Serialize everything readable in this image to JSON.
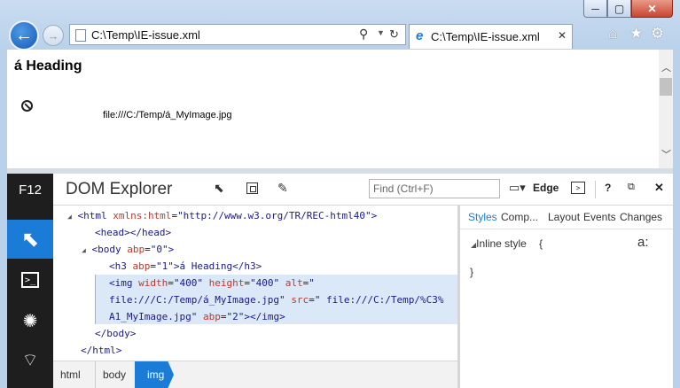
{
  "window": {
    "minimize": "─",
    "maximize": "▢",
    "close": "✕"
  },
  "nav": {
    "back": "←",
    "forward": "→"
  },
  "address": {
    "url": "C:\\Temp\\IE-issue.xml"
  },
  "tab": {
    "title": "C:\\Temp\\IE-issue.xml",
    "close": "✕"
  },
  "page": {
    "heading": "á Heading",
    "image_alt": "file:///C:/Temp/á_MyImage.jpg"
  },
  "devtools": {
    "f12_label": "F12",
    "tool_title": "DOM Explorer",
    "find_placeholder": "Find (Ctrl+F)",
    "mode_label": "Edge",
    "help": "?",
    "tree": {
      "html_open_tag": "<html",
      "html_attr": "xmlns:html",
      "html_val": "\"http://www.w3.org/TR/REC-html40\"",
      "html_end": ">",
      "head": "<head></head>",
      "body_open": "<body",
      "body_attr": "abp",
      "body_val": "\"0\"",
      "body_end": ">",
      "h3_open": "<h3",
      "h3_attr": "abp",
      "h3_val": "\"1\"",
      "h3_text": ">á Heading</h3>",
      "img_open": "<img",
      "img_width_attr": "width",
      "img_width_val": "\"400\"",
      "img_height_attr": "height",
      "img_height_val": "\"400\"",
      "img_alt_attr": "alt",
      "img_alt_val_1": "\"",
      "img_alt_val_2": "file:///C:/Temp/á_MyImage.jpg\"",
      "img_src_attr": "src",
      "img_src_val_1": "\" file:///C:/Temp/%C3%",
      "img_src_val_2": "A1_MyImage.jpg\"",
      "img_abp_attr": "abp",
      "img_abp_val": "\"2\"",
      "img_close": "></img>",
      "body_close": "</body>",
      "html_close": "</html>"
    },
    "breadcrumbs": [
      "html",
      "body",
      "img"
    ],
    "styles_tabs": [
      "Styles",
      "Comp...",
      "Layout",
      "Events",
      "Changes"
    ],
    "inline_style_label": "Inline style",
    "inline_open": "{",
    "inline_close": "}"
  }
}
